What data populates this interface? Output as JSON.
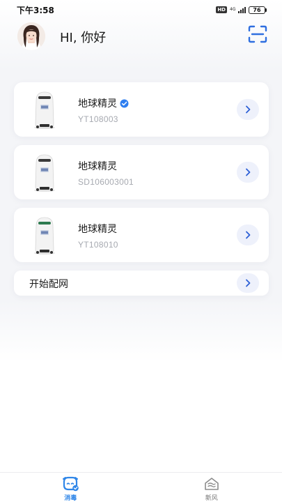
{
  "status_bar": {
    "time": "下午3:58",
    "hd": "HD",
    "network": "4G",
    "battery": "76"
  },
  "header": {
    "greeting": "HI, 你好",
    "avatar_icon": "user-avatar",
    "scan_icon": "scan-icon"
  },
  "devices": [
    {
      "name": "地球精灵",
      "serial": "YT108003",
      "verified": true
    },
    {
      "name": "地球精灵",
      "serial": "SD106003001",
      "verified": false
    },
    {
      "name": "地球精灵",
      "serial": "YT108010",
      "verified": false
    }
  ],
  "network_setup": {
    "label": "开始配网"
  },
  "tabs": [
    {
      "label": "消毒",
      "icon": "disinfect-icon",
      "active": true
    },
    {
      "label": "新风",
      "icon": "fresh-air-icon",
      "active": false
    }
  ],
  "colors": {
    "accent": "#2f86e8",
    "scan_icon": "#2f6fe0",
    "serial_text": "#a6a9b0",
    "arrow_bg": "#eef1fb",
    "verified_badge": "#2f7ff0"
  }
}
